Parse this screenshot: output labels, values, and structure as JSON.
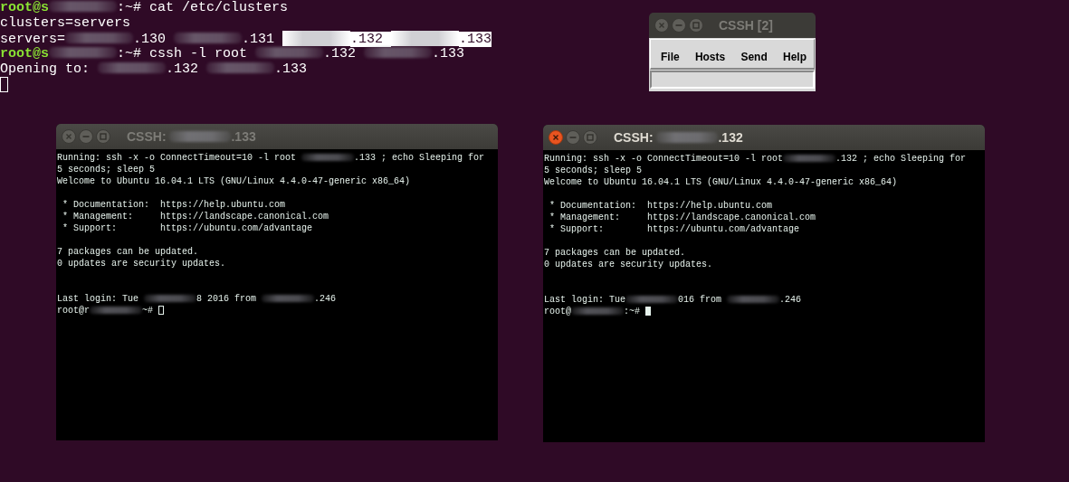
{
  "console": {
    "lines": [
      {
        "segments": [
          {
            "kind": "user",
            "text": "root@s"
          },
          {
            "kind": "blur"
          },
          {
            "kind": "text",
            "text": ":~# cat /etc/clusters"
          }
        ]
      },
      {
        "segments": [
          {
            "kind": "text",
            "text": "clusters=servers"
          }
        ]
      },
      {
        "segments": [
          {
            "kind": "text",
            "text": "servers=",
            "highlighted": false
          },
          {
            "kind": "blur",
            "highlighted": false
          },
          {
            "kind": "text",
            "text": ".130 ",
            "highlighted": false
          },
          {
            "kind": "blur",
            "highlighted": false
          },
          {
            "kind": "text",
            "text": ".131 ",
            "highlighted": false
          },
          {
            "kind": "blur",
            "highlighted": true
          },
          {
            "kind": "text",
            "text": ".132 ",
            "highlighted": true
          },
          {
            "kind": "blur",
            "highlighted": true
          },
          {
            "kind": "text",
            "text": ".133",
            "highlighted": true
          }
        ]
      },
      {
        "segments": [
          {
            "kind": "user",
            "text": "root@s"
          },
          {
            "kind": "blur"
          },
          {
            "kind": "text",
            "text": ":~# cssh -l root "
          },
          {
            "kind": "blur"
          },
          {
            "kind": "text",
            "text": ".132 "
          },
          {
            "kind": "blur"
          },
          {
            "kind": "text",
            "text": ".133"
          }
        ]
      },
      {
        "segments": [
          {
            "kind": "text",
            "text": "Opening to: "
          },
          {
            "kind": "blur"
          },
          {
            "kind": "text",
            "text": ".132 "
          },
          {
            "kind": "blur"
          },
          {
            "kind": "text",
            "text": ".133"
          }
        ]
      },
      {
        "segments": [
          {
            "kind": "cursor",
            "filled": false
          }
        ]
      }
    ]
  },
  "control_window": {
    "title": "CSSH [2]",
    "active": false,
    "menu": [
      "File",
      "Hosts",
      "Send",
      "Help"
    ]
  },
  "terminals": [
    {
      "active": false,
      "title": [
        {
          "kind": "text",
          "text": "CSSH: "
        },
        {
          "kind": "blur"
        },
        {
          "kind": "text",
          "text": ".133"
        }
      ],
      "lines": [
        {
          "segments": [
            {
              "kind": "text",
              "text": "Running: ssh -x -o ConnectTimeout=10 -l root "
            },
            {
              "kind": "blur"
            },
            {
              "kind": "text",
              "text": ".133 ; echo Sleeping for"
            }
          ]
        },
        {
          "segments": [
            {
              "kind": "text",
              "text": "5 seconds; sleep 5"
            }
          ]
        },
        {
          "segments": [
            {
              "kind": "text",
              "text": "Welcome to Ubuntu 16.04.1 LTS (GNU/Linux 4.4.0-47-generic x86_64)"
            }
          ]
        },
        {
          "kind": "blank"
        },
        {
          "segments": [
            {
              "kind": "text",
              "text": " * Documentation:  https://help.ubuntu.com"
            }
          ]
        },
        {
          "segments": [
            {
              "kind": "text",
              "text": " * Management:     https://landscape.canonical.com"
            }
          ]
        },
        {
          "segments": [
            {
              "kind": "text",
              "text": " * Support:        https://ubuntu.com/advantage"
            }
          ]
        },
        {
          "kind": "blank"
        },
        {
          "segments": [
            {
              "kind": "text",
              "text": "7 packages can be updated."
            }
          ]
        },
        {
          "segments": [
            {
              "kind": "text",
              "text": "0 updates are security updates."
            }
          ]
        },
        {
          "kind": "blank"
        },
        {
          "kind": "blank"
        },
        {
          "segments": [
            {
              "kind": "text",
              "text": "Last login: Tue "
            },
            {
              "kind": "blur"
            },
            {
              "kind": "text",
              "text": "8 2016 from "
            },
            {
              "kind": "blur"
            },
            {
              "kind": "text",
              "text": ".246"
            }
          ]
        },
        {
          "segments": [
            {
              "kind": "text",
              "text": "root@r"
            },
            {
              "kind": "blur"
            },
            {
              "kind": "text",
              "text": "~# "
            },
            {
              "kind": "cursor",
              "filled": false
            }
          ]
        }
      ]
    },
    {
      "active": true,
      "title": [
        {
          "kind": "text",
          "text": "CSSH: "
        },
        {
          "kind": "blur"
        },
        {
          "kind": "text",
          "text": ".132"
        }
      ],
      "lines": [
        {
          "segments": [
            {
              "kind": "text",
              "text": "Running: ssh -x -o ConnectTimeout=10 -l root"
            },
            {
              "kind": "blur"
            },
            {
              "kind": "text",
              "text": ".132 ; echo Sleeping for"
            }
          ]
        },
        {
          "segments": [
            {
              "kind": "text",
              "text": "5 seconds; sleep 5"
            }
          ]
        },
        {
          "segments": [
            {
              "kind": "text",
              "text": "Welcome to Ubuntu 16.04.1 LTS (GNU/Linux 4.4.0-47-generic x86_64)"
            }
          ]
        },
        {
          "kind": "blank"
        },
        {
          "segments": [
            {
              "kind": "text",
              "text": " * Documentation:  https://help.ubuntu.com"
            }
          ]
        },
        {
          "segments": [
            {
              "kind": "text",
              "text": " * Management:     https://landscape.canonical.com"
            }
          ]
        },
        {
          "segments": [
            {
              "kind": "text",
              "text": " * Support:        https://ubuntu.com/advantage"
            }
          ]
        },
        {
          "kind": "blank"
        },
        {
          "segments": [
            {
              "kind": "text",
              "text": "7 packages can be updated."
            }
          ]
        },
        {
          "segments": [
            {
              "kind": "text",
              "text": "0 updates are security updates."
            }
          ]
        },
        {
          "kind": "blank"
        },
        {
          "kind": "blank"
        },
        {
          "segments": [
            {
              "kind": "text",
              "text": "Last login: Tue"
            },
            {
              "kind": "blur"
            },
            {
              "kind": "text",
              "text": "016 from "
            },
            {
              "kind": "blur"
            },
            {
              "kind": "text",
              "text": ".246"
            }
          ]
        },
        {
          "segments": [
            {
              "kind": "text",
              "text": "root@"
            },
            {
              "kind": "blur"
            },
            {
              "kind": "text",
              "text": ":~# "
            },
            {
              "kind": "cursor",
              "filled": true
            }
          ]
        }
      ]
    }
  ]
}
